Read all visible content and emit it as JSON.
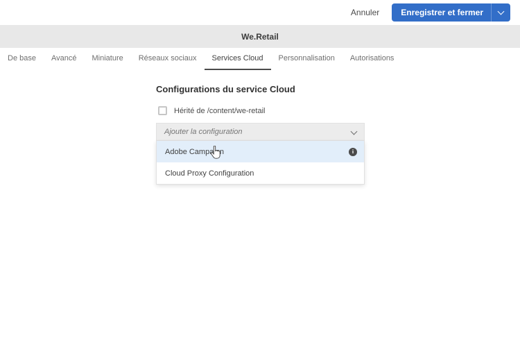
{
  "top_bar": {
    "cancel_label": "Annuler",
    "save_label": "Enregistrer et fermer"
  },
  "header": {
    "title": "We.Retail"
  },
  "tabs": {
    "items": [
      {
        "label": "De base",
        "active": false
      },
      {
        "label": "Avancé",
        "active": false
      },
      {
        "label": "Miniature",
        "active": false
      },
      {
        "label": "Réseaux sociaux",
        "active": false
      },
      {
        "label": "Services Cloud",
        "active": true
      },
      {
        "label": "Personnalisation",
        "active": false
      },
      {
        "label": "Autorisations",
        "active": false
      }
    ]
  },
  "content": {
    "heading": "Configurations du service Cloud",
    "inherit_checkbox": {
      "checked": false,
      "label": "Hérité de /content/we-retail"
    },
    "config_select": {
      "placeholder": "Ajouter la configuration"
    },
    "dropdown_items": [
      {
        "label": "Adobe Campaign",
        "highlighted": true,
        "has_info_icon": true
      },
      {
        "label": "Cloud Proxy Configuration",
        "highlighted": false,
        "has_info_icon": false
      }
    ]
  },
  "icons": {
    "info": "i"
  },
  "colors": {
    "accent_blue": "#326EC8",
    "header_gray": "#E8E8E8",
    "highlight_blue": "#E2EEFA"
  }
}
